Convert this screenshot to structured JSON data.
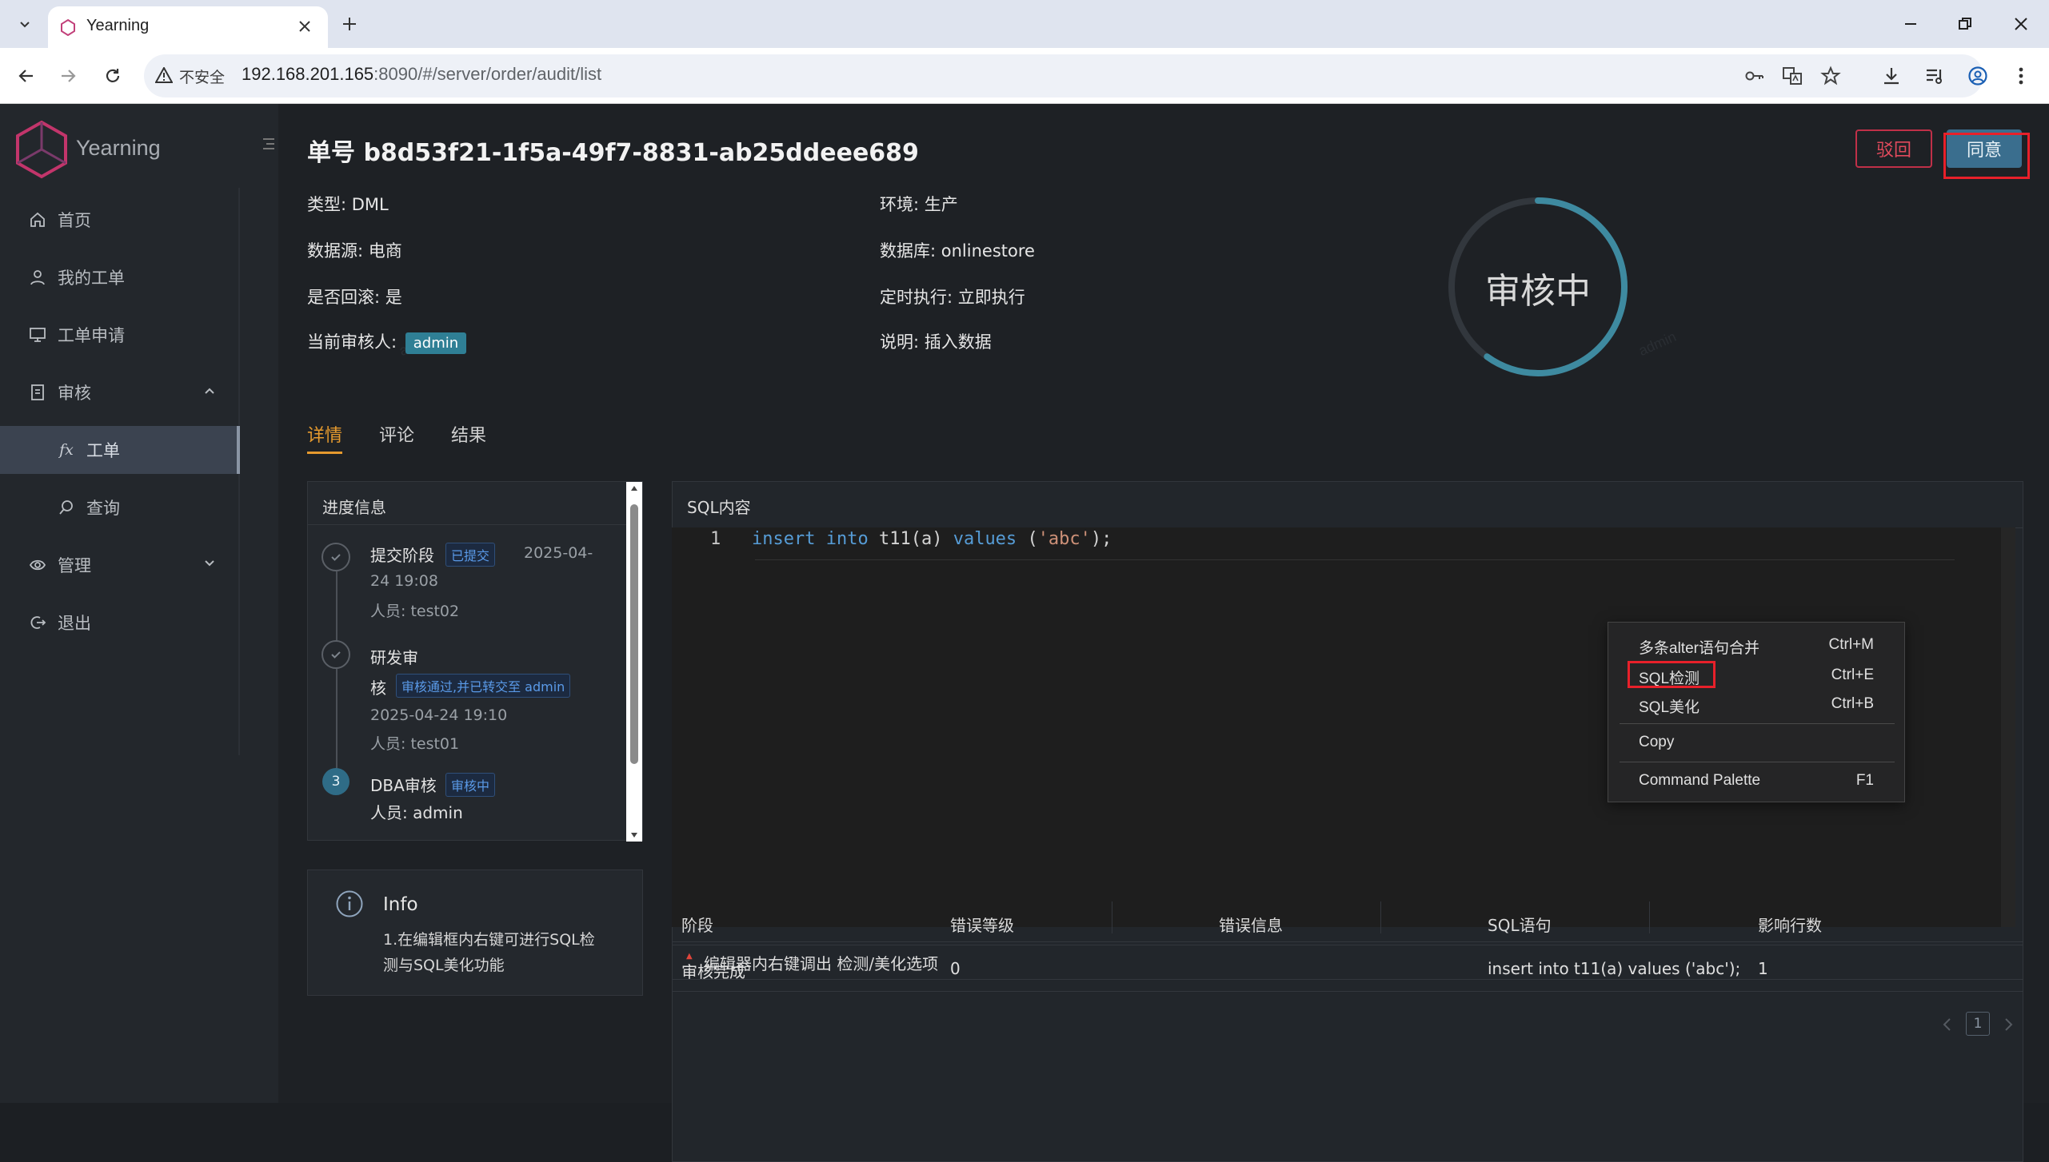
{
  "browser": {
    "tab_title": "Yearning",
    "security_label": "不安全",
    "url_host": "192.168.201.165",
    "url_rest": ":8090/#/server/order/audit/list"
  },
  "sidebar": {
    "brand": "Yearning",
    "items": [
      {
        "label": "首页",
        "icon": "home-icon"
      },
      {
        "label": "我的工单",
        "icon": "user-icon"
      },
      {
        "label": "工单申请",
        "icon": "monitor-icon"
      },
      {
        "label": "审核",
        "icon": "audit-icon"
      },
      {
        "label": "工单",
        "icon": "fx-icon"
      },
      {
        "label": "查询",
        "icon": "search-icon"
      },
      {
        "label": "管理",
        "icon": "manage-icon"
      },
      {
        "label": "退出",
        "icon": "logout-icon"
      }
    ]
  },
  "order": {
    "title": "单号 b8d53f21-1f5a-49f7-8831-ab25ddeee689",
    "type_label": "类型:",
    "type": "DML",
    "source_label": "数据源:",
    "source": "电商",
    "rollback_label": "是否回滚:",
    "rollback": "是",
    "reviewer_label": "当前审核人:",
    "reviewer": "admin",
    "env_label": "环境:",
    "env": "生产",
    "db_label": "数据库:",
    "db": "onlinestore",
    "schedule_label": "定时执行:",
    "schedule": "立即执行",
    "desc_label": "说明:",
    "desc": "插入数据",
    "status": "审核中",
    "status_progress": 0.6,
    "reject_btn": "驳回",
    "agree_btn": "同意"
  },
  "tabs": [
    "详情",
    "评论",
    "结果"
  ],
  "progress": {
    "header": "进度信息",
    "steps": [
      {
        "name": "提交阶段",
        "tag": "已提交",
        "time_a": "2025-04-",
        "time_b": "24 19:08",
        "person": "人员: test02"
      },
      {
        "name_a": "研发审",
        "name_b": "核",
        "tag": "审核通过,并已转交至 admin",
        "time": "2025-04-24 19:10",
        "person": "人员: test01"
      },
      {
        "num": "3",
        "name": "DBA审核",
        "tag": "审核中",
        "person": "人员: admin"
      }
    ]
  },
  "info": {
    "title": "Info",
    "line1": "1.在编辑框内右键可进行SQL检",
    "line2": "测与SQL美化功能"
  },
  "sql": {
    "header": "SQL内容",
    "line_no": "1",
    "kw1": "insert",
    "kw2": "into",
    "plain1": "t11(a)",
    "kw3": "values",
    "paren_open": "(",
    "str": "'abc'",
    "paren_close": ");",
    "hint": "编辑器内右键调出 检测/美化选项"
  },
  "context_menu": [
    {
      "label": "多条alter语句合并",
      "shortcut": "Ctrl+M"
    },
    {
      "label": "SQL检测",
      "shortcut": "Ctrl+E"
    },
    {
      "label": "SQL美化",
      "shortcut": "Ctrl+B"
    },
    {
      "label": "Copy",
      "shortcut": ""
    },
    {
      "label": "Command Palette",
      "shortcut": "F1"
    }
  ],
  "result_table": {
    "columns": [
      "阶段",
      "错误等级",
      "错误信息",
      "SQL语句",
      "影响行数"
    ],
    "rows": [
      [
        "审核完成",
        "0",
        "",
        "insert into t11(a) values ('abc');",
        "1"
      ]
    ]
  },
  "pagination": {
    "current": "1"
  },
  "watermark": "admin"
}
